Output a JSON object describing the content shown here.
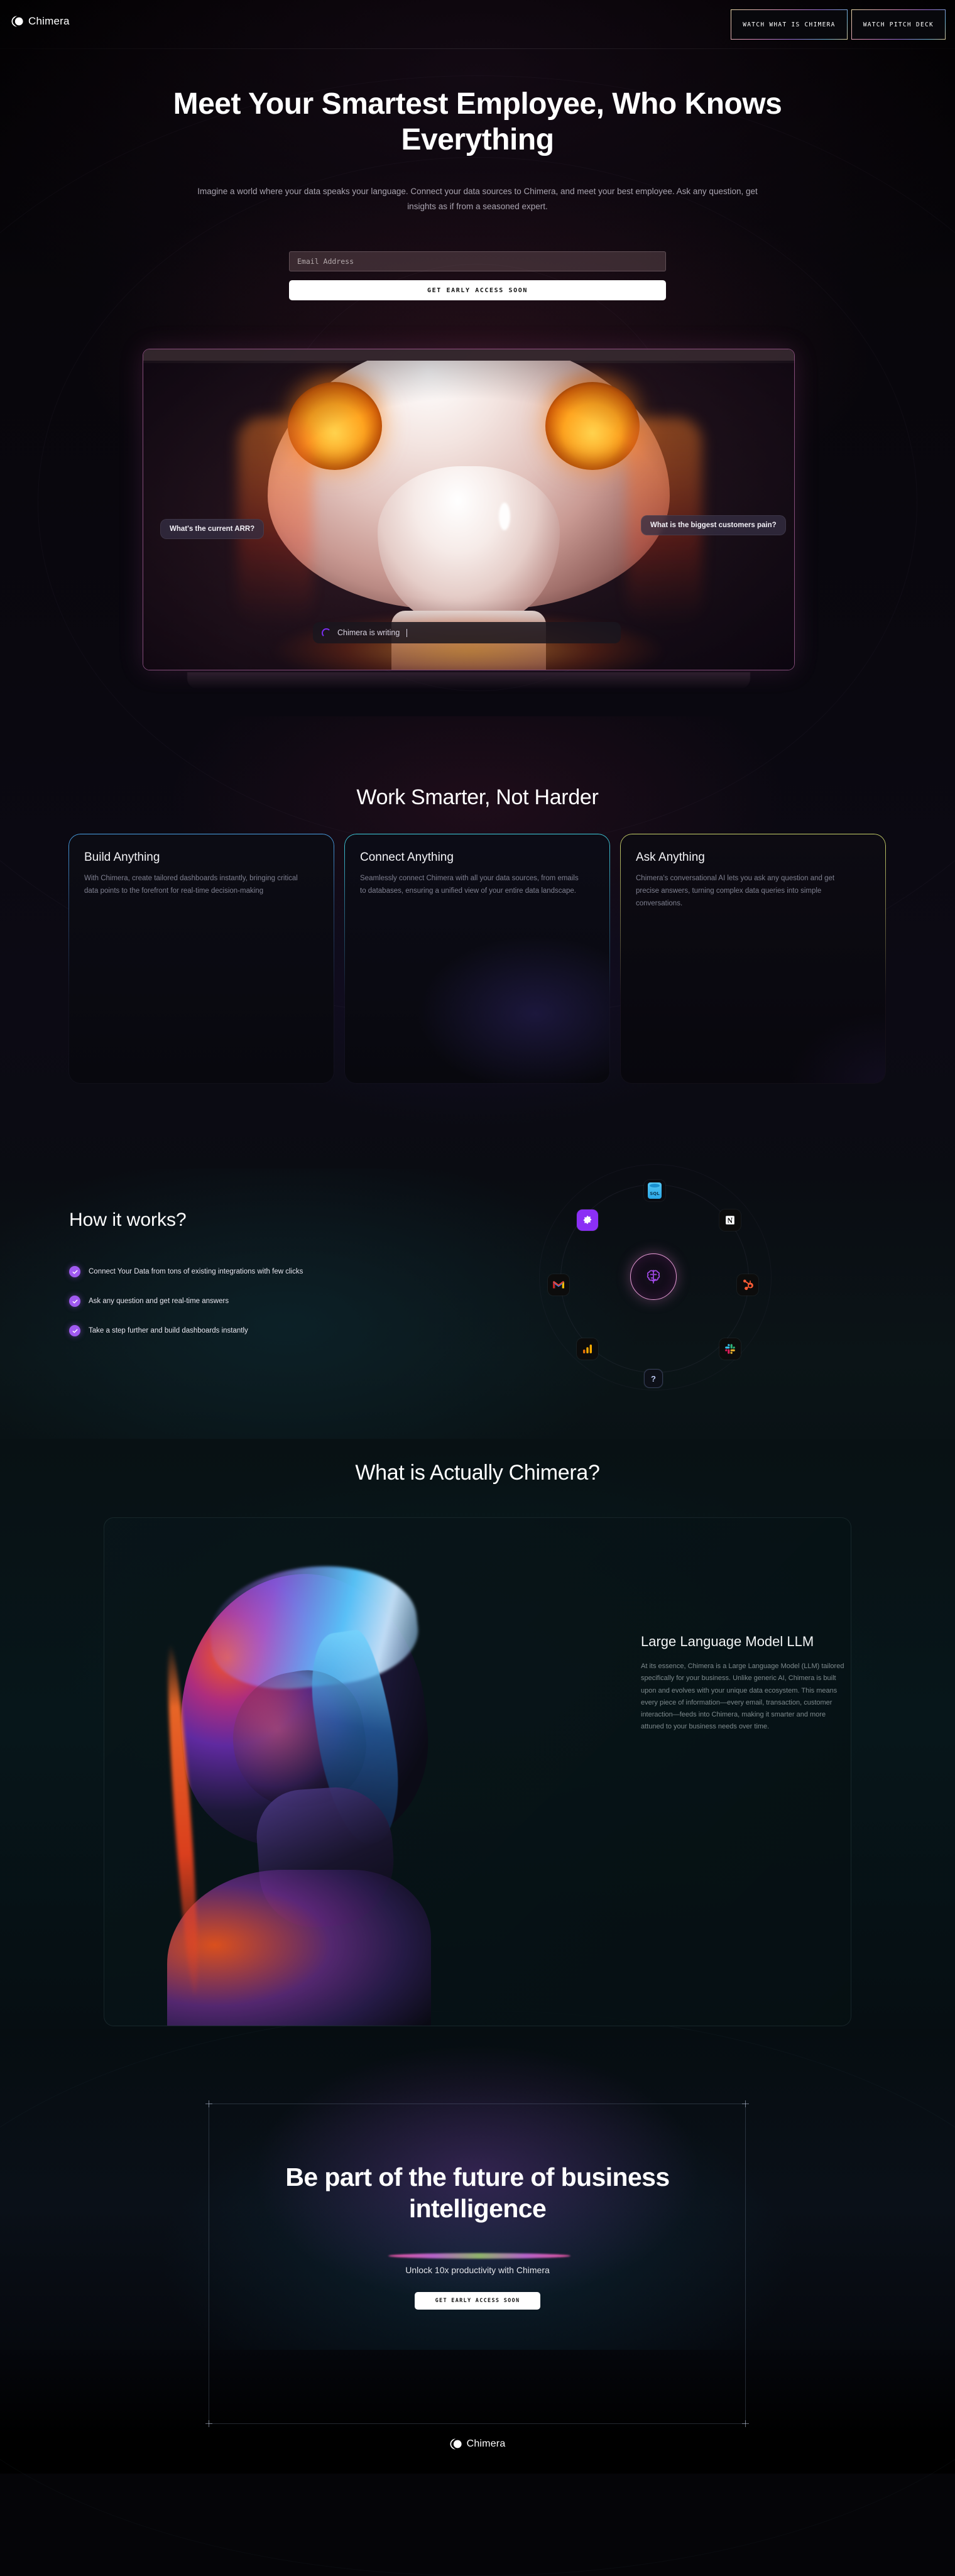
{
  "brand": {
    "name": "Chimera",
    "logo_icon": "chimera-logo-icon"
  },
  "header": {
    "buttons": [
      {
        "label": "WATCH WHAT IS CHIMERA",
        "name": "watch-what-is-chimera-button"
      },
      {
        "label": "WATCH PITCH DECK",
        "name": "watch-pitch-deck-button"
      }
    ]
  },
  "hero": {
    "title": "Meet Your Smartest Employee, Who Knows Everything",
    "subtitle": "Imagine a world where your data speaks your language. Connect your data sources to Chimera, and meet your best employee. Ask any question, get insights as if from a seasoned expert.",
    "email_placeholder": "Email Address",
    "email_value": "",
    "cta_label": "GET EARLY ACCESS SOON"
  },
  "video": {
    "bubble_left": "What's the current ARR?",
    "bubble_right": "What is the biggest customers pain?",
    "writing_status": "Chimera is writing",
    "spinner_color": "#7b2ef0"
  },
  "features": {
    "title": "Work Smarter, Not Harder",
    "cards": [
      {
        "title": "Build Anything",
        "body": "With Chimera, create tailored dashboards instantly, bringing critical data points to the forefront for real-time decision-making",
        "accent": "#4aa3e8"
      },
      {
        "title": "Connect Anything",
        "body": "Seamlessly connect Chimera with all your data sources, from emails to databases, ensuring a unified view of your entire data landscape.",
        "accent": "#3fd0e0"
      },
      {
        "title": "Ask Anything",
        "body": "Chimera's conversational AI lets you ask any question and get precise answers, turning complex data queries into simple conversations.",
        "accent": "#c9d36a"
      }
    ]
  },
  "how": {
    "title": "How it works?",
    "check_color": "#a05af0",
    "steps": [
      "Connect Your Data from tons of existing integrations with few clicks",
      "Ask any question and get real-time answers",
      "Take a step further and build dashboards instantly"
    ],
    "integrations": [
      {
        "name": "sql-database-icon",
        "label": "SQL"
      },
      {
        "name": "stripe-icon",
        "label": ""
      },
      {
        "name": "notion-icon",
        "label": "N"
      },
      {
        "name": "gmail-icon",
        "label": "M"
      },
      {
        "name": "hubspot-icon",
        "label": ""
      },
      {
        "name": "google-analytics-icon",
        "label": ""
      },
      {
        "name": "slack-icon",
        "label": ""
      },
      {
        "name": "unknown-integration-icon",
        "label": "?"
      }
    ],
    "core_icon": "brain-icon"
  },
  "llm": {
    "section_title": "What is Actually Chimera?",
    "heading": "Large Language Model LLM",
    "body": "At its essence, Chimera is a Large Language Model (LLM) tailored specifically for your business. Unlike generic AI, Chimera is built upon and evolves with your unique data ecosystem. This means every piece of information—every email, transaction, customer interaction—feeds into Chimera, making it smarter and more attuned to your business needs over time."
  },
  "cta": {
    "title": "Be part of the future of business intelligence",
    "subtitle": "Unlock 10x productivity with Chimera",
    "button_label": "GET EARLY ACCESS SOON"
  },
  "footer": {
    "brand": "Chimera"
  }
}
